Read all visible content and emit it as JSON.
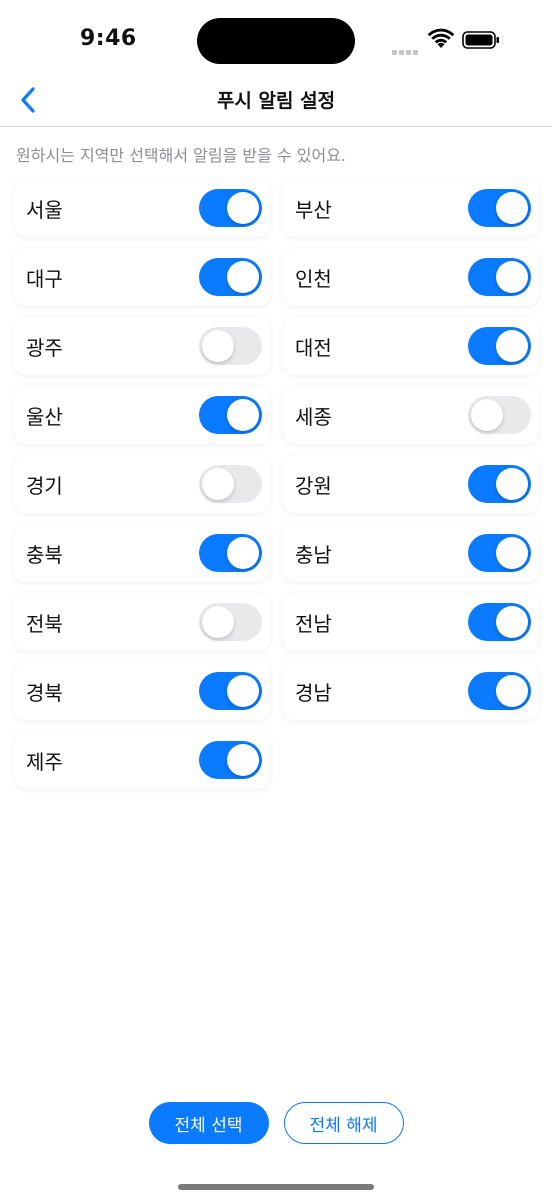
{
  "status_bar": {
    "time": "9:46"
  },
  "nav": {
    "title": "푸시 알림 설정"
  },
  "helper": {
    "text": "원하시는 지역만 선택해서 알림을 받을 수 있어요."
  },
  "accent_color": "#0a7aff",
  "regions": [
    {
      "label": "서울",
      "enabled": true
    },
    {
      "label": "부산",
      "enabled": true
    },
    {
      "label": "대구",
      "enabled": true
    },
    {
      "label": "인천",
      "enabled": true
    },
    {
      "label": "광주",
      "enabled": false
    },
    {
      "label": "대전",
      "enabled": true
    },
    {
      "label": "울산",
      "enabled": true
    },
    {
      "label": "세종",
      "enabled": false
    },
    {
      "label": "경기",
      "enabled": false
    },
    {
      "label": "강원",
      "enabled": true
    },
    {
      "label": "충북",
      "enabled": true
    },
    {
      "label": "충남",
      "enabled": true
    },
    {
      "label": "전북",
      "enabled": false
    },
    {
      "label": "전남",
      "enabled": true
    },
    {
      "label": "경북",
      "enabled": true
    },
    {
      "label": "경남",
      "enabled": true
    },
    {
      "label": "제주",
      "enabled": true
    }
  ],
  "actions": {
    "select_all": "전체 선택",
    "deselect_all": "전체 해제"
  }
}
